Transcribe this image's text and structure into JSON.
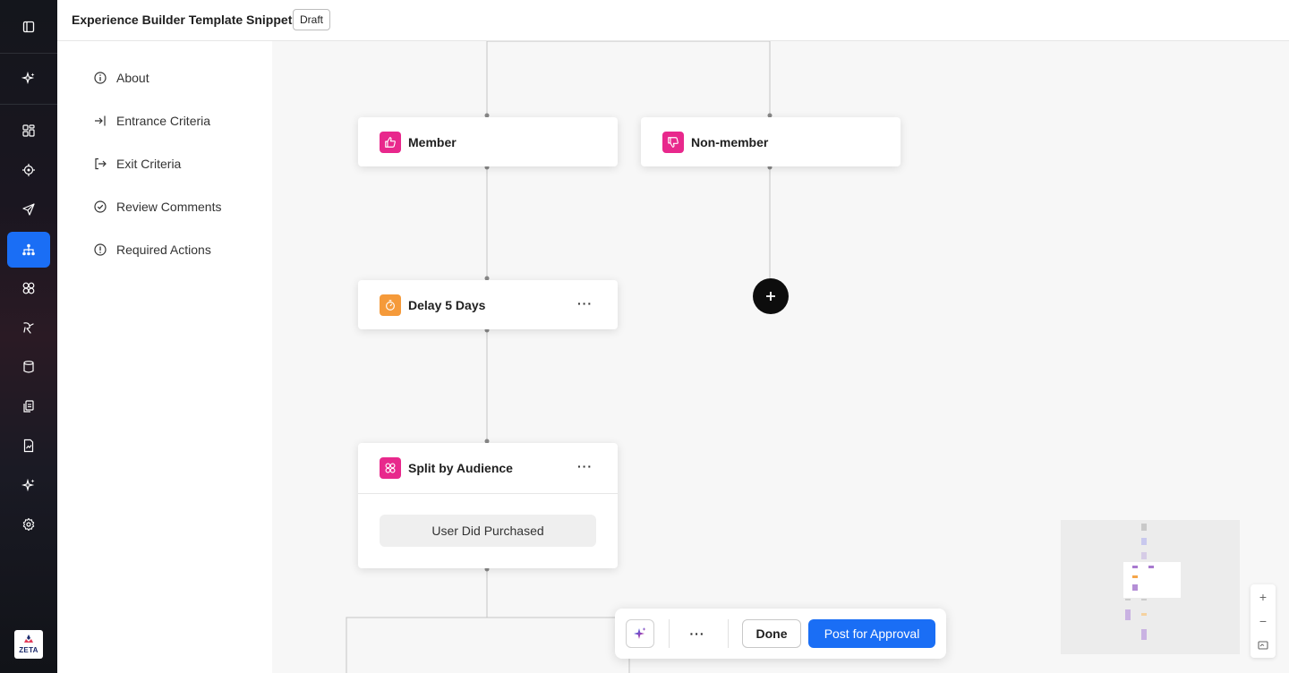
{
  "header": {
    "title": "Experience Builder Template Snippets",
    "status_badge": "Draft"
  },
  "rail": {
    "items": [
      {
        "icon": "sparkle-icon"
      },
      {
        "icon": "dashboard-grid-icon"
      },
      {
        "icon": "target-icon"
      },
      {
        "icon": "send-icon"
      },
      {
        "icon": "journey-hierarchy-icon",
        "active": true
      },
      {
        "icon": "audience-circles-icon"
      },
      {
        "icon": "handshake-icon"
      },
      {
        "icon": "database-icon"
      },
      {
        "icon": "copy-files-icon"
      },
      {
        "icon": "report-file-icon"
      },
      {
        "icon": "ai-sparkle-icon"
      },
      {
        "icon": "settings-gear-icon"
      }
    ],
    "brand": "ZETA"
  },
  "subnav": {
    "items": [
      {
        "label": "About",
        "icon": "info-icon"
      },
      {
        "label": "Entrance Criteria",
        "icon": "enter-icon"
      },
      {
        "label": "Exit Criteria",
        "icon": "exit-icon"
      },
      {
        "label": "Review Comments",
        "icon": "check-circle-icon"
      },
      {
        "label": "Required Actions",
        "icon": "alert-circle-icon"
      }
    ]
  },
  "canvas": {
    "nodes": {
      "member": {
        "label": "Member",
        "icon": "thumbs-up-icon"
      },
      "non_member": {
        "label": "Non-member",
        "icon": "thumbs-down-icon"
      },
      "delay": {
        "label": "Delay 5 Days",
        "icon": "timer-icon",
        "menu": "···"
      },
      "split": {
        "label": "Split by Audience",
        "icon": "audience-icon",
        "menu": "···",
        "branch": "User Did Purchased"
      }
    },
    "add_button_icon": "plus-icon"
  },
  "zoom": {
    "plus": "+",
    "minus": "−"
  },
  "toolbar": {
    "ai_icon": "sparkle-icon",
    "more": "···",
    "done": "Done",
    "post": "Post for Approval"
  },
  "colors": {
    "accent": "#1a6ef5",
    "pink": "#e8288c",
    "orange": "#f59a3a"
  }
}
